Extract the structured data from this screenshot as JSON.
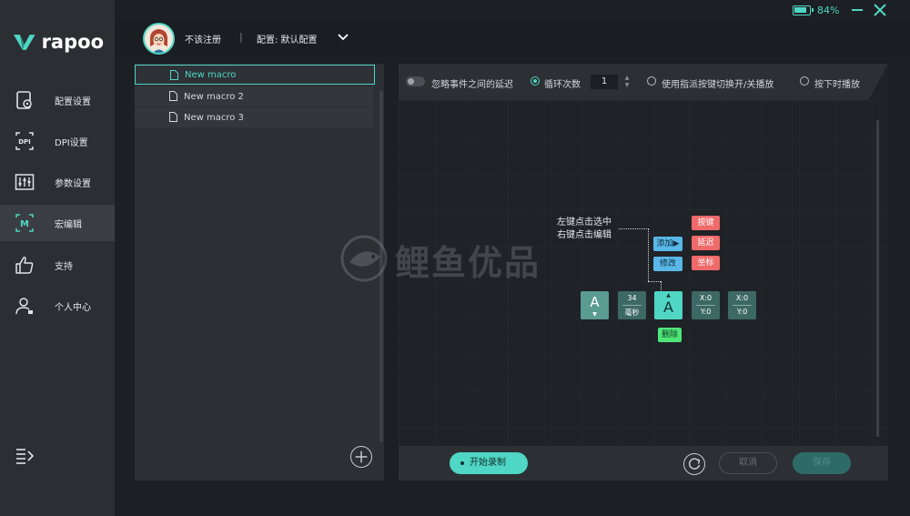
{
  "titlebar": {
    "battery_percent": 84,
    "battery_text": "84%"
  },
  "brand": {
    "name": "rapoo",
    "accent_color": "#4fd6c4"
  },
  "sidebar": {
    "items": [
      {
        "label": "配置设置",
        "icon": "config-icon"
      },
      {
        "label": "DPI设置",
        "icon": "dpi-icon",
        "icon_text": "DPI"
      },
      {
        "label": "参数设置",
        "icon": "sliders-icon"
      },
      {
        "label": "宏编辑",
        "icon": "macro-icon",
        "icon_text": "M",
        "active": true
      },
      {
        "label": "支持",
        "icon": "thumbs-up-icon"
      },
      {
        "label": "个人中心",
        "icon": "user-icon"
      }
    ]
  },
  "header": {
    "username": "不该注册",
    "separator": "|",
    "config_label": "配置: 默认配置"
  },
  "macros": {
    "items": [
      {
        "name": "New macro",
        "selected": true
      },
      {
        "name": "New macro 2",
        "selected": false
      },
      {
        "name": "New macro 3",
        "selected": false
      }
    ]
  },
  "toolbar": {
    "ignore_delay_label": "忽略事件之间的延迟",
    "loop_count_label": "循环次数",
    "loop_count_value": "1",
    "toggle_key_label": "使用指派按键切换开/关播放",
    "hold_play_label": "按下时播放"
  },
  "diagram": {
    "hint_line1": "左键点击选中",
    "hint_line2": "右键点击编辑",
    "add_label": "添加▶",
    "modify_label": "修改",
    "menu_key": "按键",
    "menu_delay": "延迟",
    "menu_coord": "坐标",
    "delete_label": "删除",
    "node1_key": "A",
    "node2_value": "34",
    "node2_unit": "毫秒",
    "node3_key": "A",
    "node4_x": "X:0",
    "node4_y": "Y:0",
    "node5_x": "X:0",
    "node5_y": "Y:0"
  },
  "watermark": {
    "text": "鲤鱼优品"
  },
  "footer": {
    "record_label": "开始录制",
    "cancel_label": "取消",
    "save_label": "保存"
  }
}
